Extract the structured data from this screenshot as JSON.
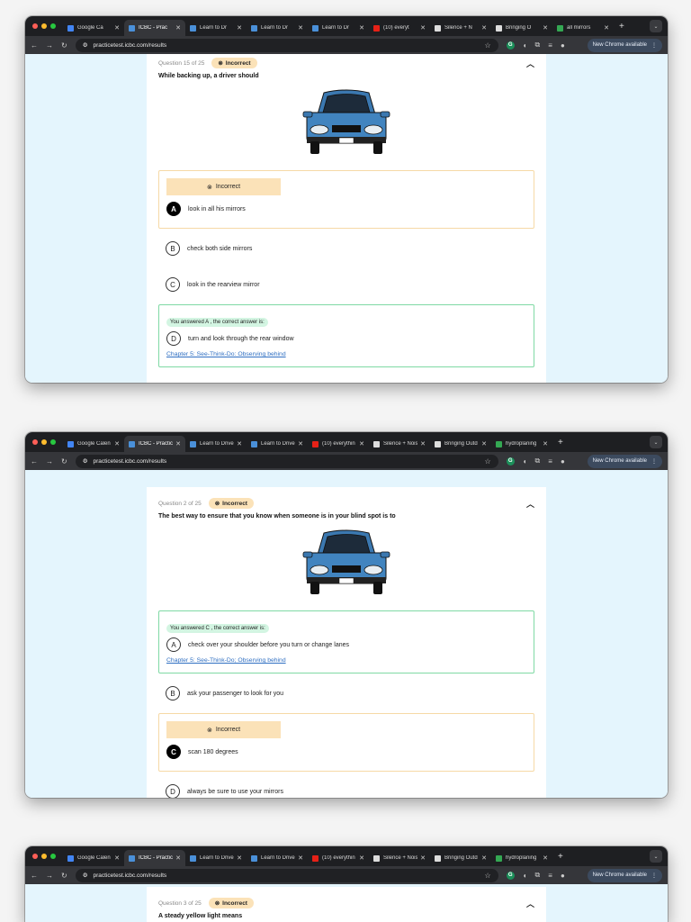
{
  "colors": {
    "page_bg": "#e4f5fd",
    "incorrect": "#fbe2b8",
    "correct": "#d3f5e2",
    "link": "#2f6fc2"
  },
  "windows": [
    {
      "tabs": [
        {
          "label": "Google Ca",
          "fav": "#4285f4"
        },
        {
          "label": "ICBC - Prac",
          "fav": "#4a90d9",
          "active": true
        },
        {
          "label": "Learn to Dr",
          "fav": "#4a90d9"
        },
        {
          "label": "Learn to Dr",
          "fav": "#4a90d9"
        },
        {
          "label": "Learn to Dr",
          "fav": "#4a90d9"
        },
        {
          "label": "(10) everyt",
          "fav": "#e62117"
        },
        {
          "label": "Silence + N",
          "fav": "#ddd"
        },
        {
          "label": "Bringing O",
          "fav": "#ddd"
        },
        {
          "label": "all mirrors",
          "fav": "#34a853"
        }
      ],
      "url": "practicetest.icbc.com/results",
      "new_chrome": "New Chrome available",
      "question": {
        "counter": "Question 15 of 25",
        "status": "Incorrect",
        "text": "While backing up, a driver should",
        "options": [
          {
            "type": "wrong",
            "letter": "A",
            "text": "look in all his mirrors",
            "badge": "Incorrect"
          },
          {
            "type": "plain",
            "letter": "B",
            "text": "check both side mirrors"
          },
          {
            "type": "plain",
            "letter": "C",
            "text": "look in the rearview mirror"
          },
          {
            "type": "right",
            "letter": "D",
            "text": "turn and look through the rear window",
            "note": "You answered A , the correct answer is:",
            "link": "Chapter 5: See-Think-Do: Observing behind"
          }
        ]
      }
    },
    {
      "tabs": [
        {
          "label": "Google Calen",
          "fav": "#4285f4"
        },
        {
          "label": "ICBC - Practic",
          "fav": "#4a90d9",
          "active": true
        },
        {
          "label": "Learn to Drive",
          "fav": "#4a90d9"
        },
        {
          "label": "Learn to Drive",
          "fav": "#4a90d9"
        },
        {
          "label": "(10) everythin",
          "fav": "#e62117"
        },
        {
          "label": "Silence + Nois",
          "fav": "#ddd"
        },
        {
          "label": "Bringing Outd",
          "fav": "#ddd"
        },
        {
          "label": "hydroplaning",
          "fav": "#34a853"
        }
      ],
      "url": "practicetest.icbc.com/results",
      "new_chrome": "New Chrome available",
      "question": {
        "counter": "Question 2 of 25",
        "status": "Incorrect",
        "text": "The best way to ensure that you know when someone is in your blind spot is to",
        "options": [
          {
            "type": "right",
            "letter": "A",
            "text": "check over your shoulder before you turn or change lanes",
            "note": "You answered C , the correct answer is:",
            "link": "Chapter 5: See-Think-Do; Observing behind"
          },
          {
            "type": "plain",
            "letter": "B",
            "text": "ask your passenger to look for you"
          },
          {
            "type": "wrong",
            "letter": "C",
            "text": "scan 180 degrees",
            "badge": "Incorrect"
          },
          {
            "type": "plain",
            "letter": "D",
            "text": "always be sure to use your mirrors"
          }
        ]
      }
    },
    {
      "tabs": [
        {
          "label": "Google Calen",
          "fav": "#4285f4"
        },
        {
          "label": "ICBC - Practic",
          "fav": "#4a90d9",
          "active": true
        },
        {
          "label": "Learn to Drive",
          "fav": "#4a90d9"
        },
        {
          "label": "Learn to Drive",
          "fav": "#4a90d9"
        },
        {
          "label": "(10) everythin",
          "fav": "#e62117"
        },
        {
          "label": "Silence + Nois",
          "fav": "#ddd"
        },
        {
          "label": "Bringing Outd",
          "fav": "#ddd"
        },
        {
          "label": "hydroplaning",
          "fav": "#34a853"
        }
      ],
      "url": "practicetest.icbc.com/results",
      "new_chrome": "New Chrome available",
      "question": {
        "counter": "Question 3 of 25",
        "status": "Incorrect",
        "text": "A steady yellow light means",
        "options": []
      }
    }
  ]
}
